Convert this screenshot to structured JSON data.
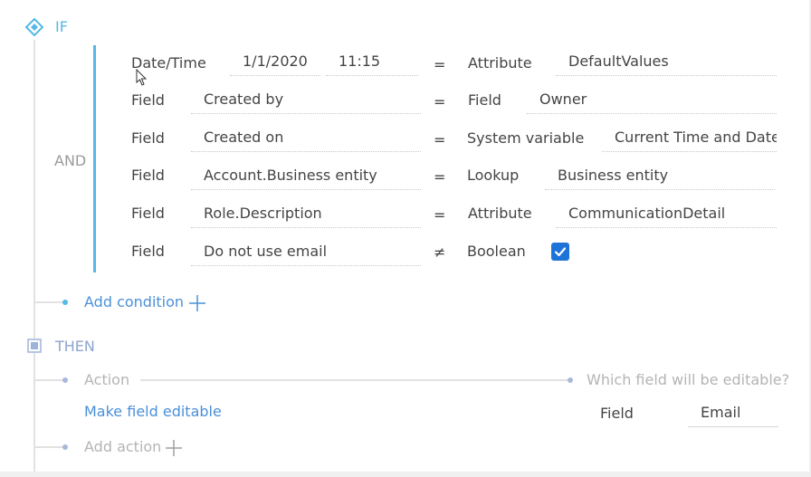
{
  "if_section": {
    "label": "IF",
    "group_operator": "AND"
  },
  "conditions": [
    {
      "type": "Date/Time",
      "date": "1/1/2020",
      "time": "11:15",
      "operator": "=",
      "value_type": "Attribute",
      "value": "DefaultValues"
    },
    {
      "type": "Field",
      "field": "Created by",
      "operator": "=",
      "value_type": "Field",
      "value": "Owner"
    },
    {
      "type": "Field",
      "field": "Created on",
      "operator": "=",
      "value_type": "System variable",
      "value": "Current Time and Date"
    },
    {
      "type": "Field",
      "field": "Account.Business entity",
      "operator": "=",
      "value_type": "Lookup",
      "value": "Business entity"
    },
    {
      "type": "Field",
      "field": "Role.Description",
      "operator": "=",
      "value_type": "Attribute",
      "value": "CommunicationDetail"
    },
    {
      "type": "Field",
      "field": "Do not use email",
      "operator": "≠",
      "value_type": "Boolean",
      "value_checked": true
    }
  ],
  "add_condition": {
    "label": "Add condition"
  },
  "then_section": {
    "label": "THEN",
    "action_header": "Action",
    "which_field_header": "Which field will be editable?",
    "action_value": "Make field editable",
    "field_label": "Field",
    "field_value": "Email"
  },
  "add_action": {
    "label": "Add action"
  },
  "colors": {
    "accent": "#4a90d9",
    "if_icon": "#55b8e6",
    "checkbox": "#1e73d9"
  }
}
